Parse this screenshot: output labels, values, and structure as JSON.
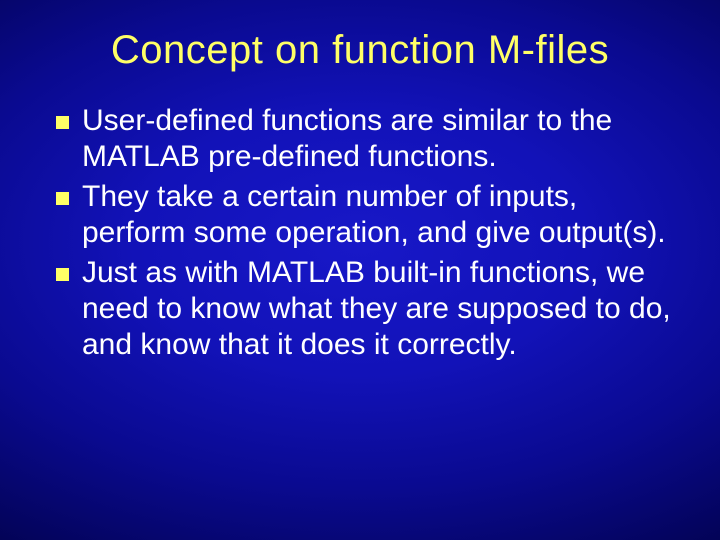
{
  "slide": {
    "title": "Concept on function M-files",
    "bullets": [
      "User-defined functions are similar to the MATLAB pre-defined functions.",
      "They take a certain number of inputs, perform some operation, and give output(s).",
      "Just as with MATLAB built-in functions, we need to know what they are supposed to do, and know that it does it correctly."
    ]
  }
}
